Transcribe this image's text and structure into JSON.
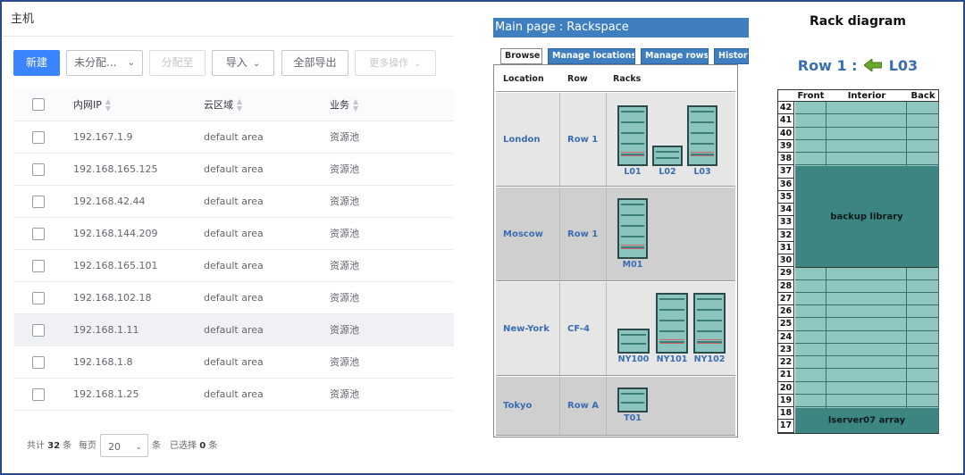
{
  "hosts": {
    "title": "主机",
    "toolbar": {
      "new_label": "新建",
      "assign_select": "未分配...",
      "assign_to_label": "分配至",
      "import_label": "导入",
      "export_all_label": "全部导出",
      "more_label": "更多操作"
    },
    "columns": [
      "内网IP",
      "云区域",
      "业务"
    ],
    "rows": [
      {
        "ip": "192.167.1.9",
        "area": "default area",
        "biz": "资源池"
      },
      {
        "ip": "192.168.165.125",
        "area": "default area",
        "biz": "资源池"
      },
      {
        "ip": "192.168.42.44",
        "area": "default area",
        "biz": "资源池"
      },
      {
        "ip": "192.168.144.209",
        "area": "default area",
        "biz": "资源池"
      },
      {
        "ip": "192.168.165.101",
        "area": "default area",
        "biz": "资源池"
      },
      {
        "ip": "192.168.102.18",
        "area": "default area",
        "biz": "资源池"
      },
      {
        "ip": "192.168.1.11",
        "area": "default area",
        "biz": "资源池"
      },
      {
        "ip": "192.168.1.8",
        "area": "default area",
        "biz": "资源池"
      },
      {
        "ip": "192.168.1.25",
        "area": "default area",
        "biz": "资源池"
      }
    ],
    "highlighted_row": 6,
    "footer": {
      "total_prefix": "共计",
      "total": "32",
      "total_suffix": "条",
      "per_page_label": "每页",
      "per_page": "20",
      "per_page_suffix": "条",
      "selected_prefix": "已选择",
      "selected": "0",
      "selected_suffix": "条"
    }
  },
  "rackspace": {
    "title": "Main page : Rackspace",
    "tabs": [
      "Browse",
      "Manage locations",
      "Manage rows",
      "History"
    ],
    "active_tab": "Browse",
    "headers": [
      "Location",
      "Row",
      "Racks"
    ],
    "locations": [
      {
        "name": "London",
        "row": "Row 1",
        "racks": [
          "L01",
          "L02",
          "L03"
        ]
      },
      {
        "name": "Moscow",
        "row": "Row 1",
        "racks": [
          "M01"
        ]
      },
      {
        "name": "New-York",
        "row": "CF-4",
        "racks": [
          "NY100",
          "NY101",
          "NY102"
        ]
      },
      {
        "name": "Tokyo",
        "row": "Row A",
        "racks": [
          "T01"
        ]
      }
    ]
  },
  "diagram": {
    "title": "Rack diagram",
    "row_label": "Row 1 :",
    "rack_label": "L03",
    "columns": [
      "Front",
      "Interior",
      "Back"
    ],
    "units": [
      42,
      41,
      40,
      39,
      38,
      37,
      36,
      35,
      34,
      33,
      32,
      31,
      30,
      29,
      28,
      27,
      26,
      25,
      24,
      23,
      22,
      21,
      20,
      19,
      18,
      17
    ],
    "blocks": [
      {
        "label": "backup library",
        "top_unit": 37,
        "bottom_unit": 30
      },
      {
        "label": "lserver07 array",
        "top_unit": 18,
        "bottom_unit": 17
      }
    ],
    "colors": {
      "slot": "#8fc7c0",
      "block": "#3c8580",
      "link": "#3a6eb0"
    }
  }
}
